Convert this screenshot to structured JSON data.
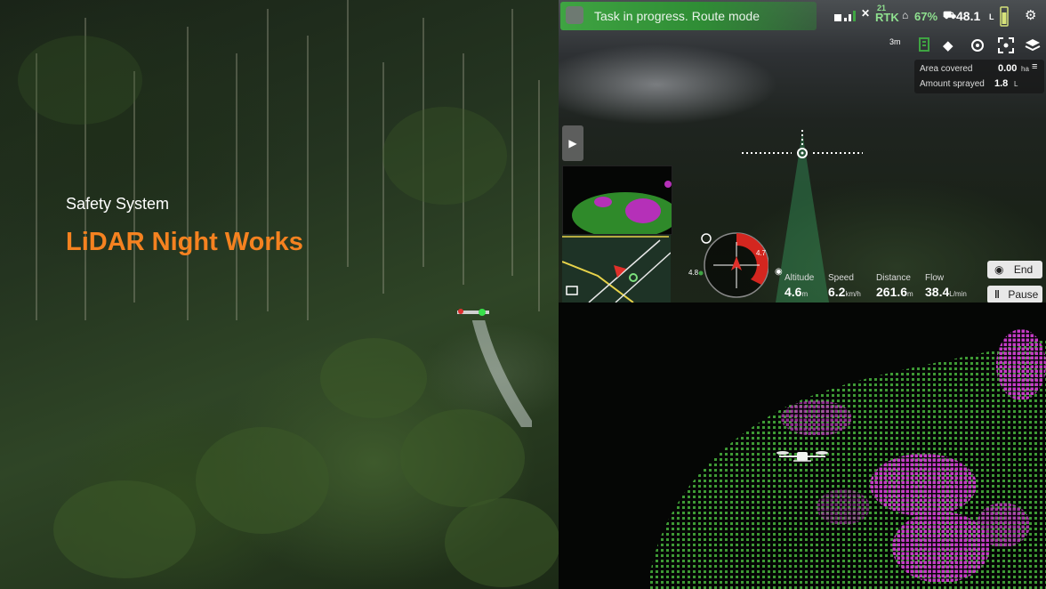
{
  "overlay": {
    "subtitle": "Safety System",
    "title": "LiDAR Night Works",
    "title_color": "#f58220"
  },
  "app": {
    "status": "Task in progress. Route mode",
    "signal_icon": "signal-bars-icon",
    "rtk_count": "21",
    "rtk_label": "RTK",
    "battery_label": "67%",
    "tank_value": "48.1",
    "tank_unit": "L",
    "toolbar": {
      "range": "3m",
      "icons": [
        "spray-nozzle-icon",
        "eraser-icon",
        "target-icon",
        "scan-icon",
        "layers-icon"
      ]
    },
    "info": {
      "area_label": "Area covered",
      "area_value": "0.00",
      "area_unit": "ha",
      "sprayed_label": "Amount sprayed",
      "sprayed_value": "1.8",
      "sprayed_unit": "L"
    },
    "compass": {
      "left_value": "4.8",
      "right_value": "4.7"
    },
    "telemetry": [
      {
        "label": "Altitude",
        "value": "4.6",
        "unit": "m"
      },
      {
        "label": "Speed",
        "value": "6.2",
        "unit": "km/h"
      },
      {
        "label": "Distance",
        "value": "261.6",
        "unit": "m"
      },
      {
        "label": "Flow",
        "value": "38.4",
        "unit": "L/min"
      }
    ],
    "buttons": {
      "end": "End",
      "pause": "Pause"
    },
    "accent_green": "#3fa442"
  }
}
